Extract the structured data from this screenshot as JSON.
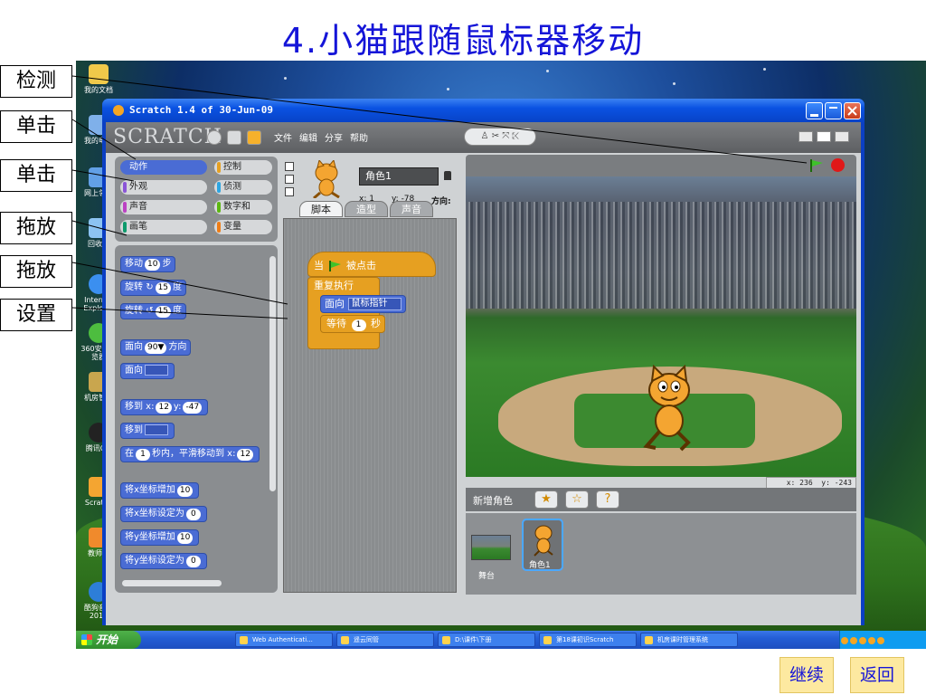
{
  "slide": {
    "title": "4.小猫跟随鼠标器移动",
    "continue_label": "继续",
    "back_label": "返回"
  },
  "annotations": [
    "检测",
    "单击",
    "单击",
    "拖放",
    "拖放",
    "设置"
  ],
  "desktop_icons": [
    {
      "label": "我的文档",
      "color": "#f0c94a"
    },
    {
      "label": "我的电脑",
      "color": "#7fb0ea"
    },
    {
      "label": "网上邻居",
      "color": "#62a0e6"
    },
    {
      "label": "回收站",
      "color": "#8cc3f2"
    },
    {
      "label": "Internet Explorer",
      "color": "#3b8ff0"
    },
    {
      "label": "360安全浏览器",
      "color": "#4dbd3f"
    },
    {
      "label": "机房管家",
      "color": "#c9a64e"
    },
    {
      "label": "腾讯QQ",
      "color": "#222222"
    },
    {
      "label": "Scratch",
      "color": "#f4a531"
    },
    {
      "label": "教师机",
      "color": "#f08a2c"
    },
    {
      "label": "酷狗音乐2012",
      "color": "#2d7ed8"
    }
  ],
  "taskbar": {
    "start_label": "开始",
    "items": [
      "Web Authenticati...",
      "遥云同管",
      "D:\\课件\\下册",
      "第18课初识Scratch",
      "机房课时管理系统"
    ]
  },
  "window": {
    "title": "Scratch 1.4 of 30-Jun-09"
  },
  "scratch": {
    "logo": "SCRATCH",
    "menu": [
      "文件",
      "编辑",
      "分享",
      "帮助"
    ],
    "categories": [
      {
        "label": "动作",
        "color": "#4a6cd4",
        "selected": true
      },
      {
        "label": "控制",
        "color": "#e6a021",
        "selected": false
      },
      {
        "label": "外观",
        "color": "#8a55d7",
        "selected": false
      },
      {
        "label": "侦测",
        "color": "#2ca5e2",
        "selected": false
      },
      {
        "label": "声音",
        "color": "#bb42c3",
        "selected": false
      },
      {
        "label": "数字和",
        "color": "#5cb712",
        "selected": false
      },
      {
        "label": "画笔",
        "color": "#0e9a6c",
        "selected": false
      },
      {
        "label": "变量",
        "color": "#ee7d16",
        "selected": false
      }
    ],
    "palette": {
      "move": {
        "text": "移动",
        "num": "10",
        "unit": "步"
      },
      "turn_right": {
        "text": "旋转",
        "num": "15",
        "unit": "度"
      },
      "turn_left": {
        "text": "旋转",
        "num": "15",
        "unit": "度"
      },
      "point_dir": {
        "text": "面向",
        "num": "90▼",
        "unit": "方向"
      },
      "point_towards": {
        "text": "面向"
      },
      "goto_xy": {
        "text": "移到 x:",
        "x": "12",
        "ylabel": "y:",
        "y": "-47"
      },
      "goto": {
        "text": "移到"
      },
      "glide": {
        "pre": "在",
        "num": "1",
        "text": "秒内，平滑移动到 x:",
        "x": "12"
      },
      "change_x": {
        "text": "将x坐标增加",
        "num": "10"
      },
      "set_x": {
        "text": "将x坐标设定为",
        "num": "0"
      },
      "change_y": {
        "text": "将y坐标增加",
        "num": "10"
      },
      "set_y": {
        "text": "将y坐标设定为",
        "num": "0"
      }
    },
    "sprite": {
      "name": "角色1",
      "x_label": "x: 1",
      "y_label": "y: -78",
      "dir_label": "方向:"
    },
    "tabs": [
      "脚本",
      "造型",
      "声音"
    ],
    "script": {
      "hat": "当",
      "hat_suffix": "被点击",
      "forever": "重复执行",
      "point_towards": "面向",
      "point_target": "鼠标指针",
      "wait": "等待",
      "wait_num": "1",
      "wait_unit": "秒"
    },
    "stage": {
      "mouse_x": "x: 236",
      "mouse_y": "y: -243"
    },
    "new_sprite_label": "新增角色",
    "sprite_list": [
      {
        "label": "舞台"
      },
      {
        "label": "角色1"
      }
    ]
  }
}
